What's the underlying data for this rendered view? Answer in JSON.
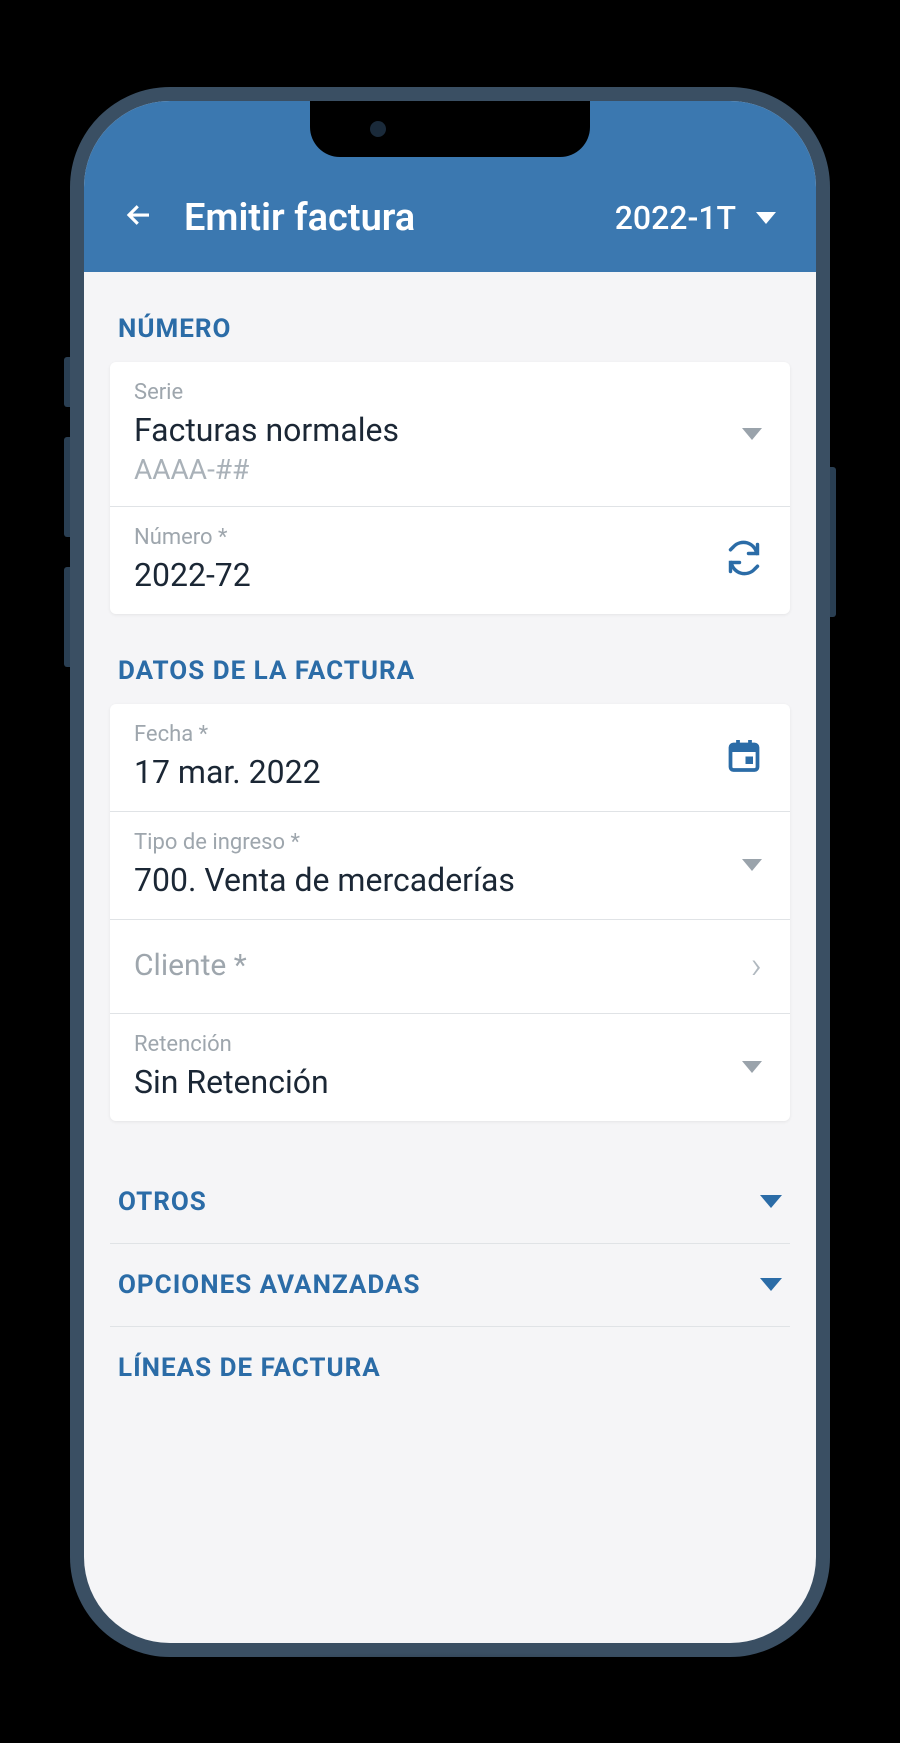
{
  "header": {
    "title": "Emitir factura",
    "period": "2022-1T"
  },
  "sections": {
    "numero": {
      "title": "NÚMERO",
      "serie_label": "Serie",
      "serie_value": "Facturas normales",
      "serie_hint": "AAAA-##",
      "numero_label": "Número *",
      "numero_value": "2022-72"
    },
    "datos": {
      "title": "DATOS DE LA FACTURA",
      "fecha_label": "Fecha *",
      "fecha_value": "17 mar. 2022",
      "tipo_label": "Tipo de ingreso *",
      "tipo_value": "700. Venta de mercaderías",
      "cliente_label": "Cliente *",
      "retencion_label": "Retención",
      "retencion_value": "Sin Retención"
    },
    "otros": {
      "title": "OTROS"
    },
    "avanzadas": {
      "title": "OPCIONES AVANZADAS"
    },
    "lineas": {
      "title": "LÍNEAS DE FACTURA"
    }
  }
}
